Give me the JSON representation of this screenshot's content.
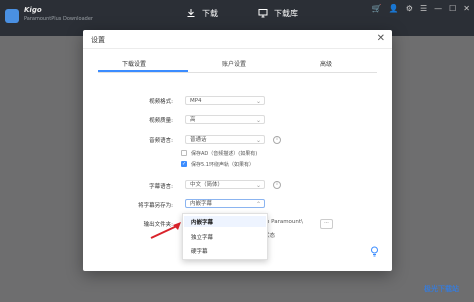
{
  "app": {
    "name": "Kigo",
    "subtitle": "ParamountPlus Downloader"
  },
  "nav": {
    "download": "下载",
    "library": "下载库"
  },
  "dialog": {
    "title": "设置",
    "close": "✕",
    "tabs": [
      "下载设置",
      "账户设置",
      "高级"
    ],
    "rows": {
      "video_format": {
        "label": "视频格式:",
        "value": "MP4"
      },
      "video_quality": {
        "label": "视频质量:",
        "value": "高"
      },
      "audio_lang": {
        "label": "音频语言:",
        "value": "普通话"
      },
      "save_ad": "保存AD（音频描述）(如果有)",
      "save_51": "保存5.1环绕声轨（如果有）",
      "subtitle_lang": {
        "label": "字幕语言:",
        "value": "中文（简体）"
      },
      "subtitle_save_as": {
        "label": "将字幕另存为:",
        "value": "内嵌字幕"
      },
      "output_folder": {
        "label": "输出文件夹:",
        "value": "igo Paramount\\",
        "browse": "···"
      },
      "status_tail": "状态"
    },
    "dropdown": [
      "内嵌字幕",
      "独立字幕",
      "硬字幕"
    ]
  },
  "watermark": "极光下载站"
}
